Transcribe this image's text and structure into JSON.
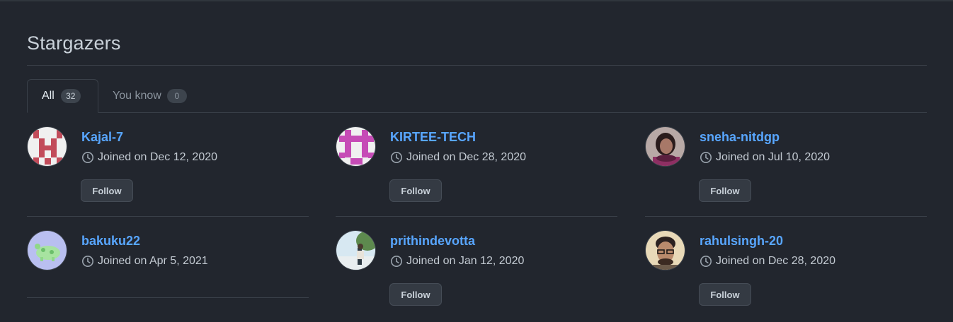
{
  "page": {
    "title": "Stargazers"
  },
  "tabs": [
    {
      "label": "All",
      "count": "32"
    },
    {
      "label": "You know",
      "count": "0"
    }
  ],
  "follow_label": "Follow",
  "users": [
    {
      "username": "Kajal-7",
      "joined": "Joined on Dec 12, 2020",
      "has_follow": true
    },
    {
      "username": "KIRTEE-TECH",
      "joined": "Joined on Dec 28, 2020",
      "has_follow": true
    },
    {
      "username": "sneha-nitdgp",
      "joined": "Joined on Jul 10, 2020",
      "has_follow": true
    },
    {
      "username": "bakuku22",
      "joined": "Joined on Apr 5, 2021",
      "has_follow": false
    },
    {
      "username": "prithindevotta",
      "joined": "Joined on Jan 12, 2020",
      "has_follow": true
    },
    {
      "username": "rahulsingh-20",
      "joined": "Joined on Dec 28, 2020",
      "has_follow": true
    }
  ],
  "colors": {
    "background": "#22262e",
    "link": "#58a6ff",
    "border": "#3a4049"
  },
  "icons": {
    "joined": "clock-icon"
  }
}
